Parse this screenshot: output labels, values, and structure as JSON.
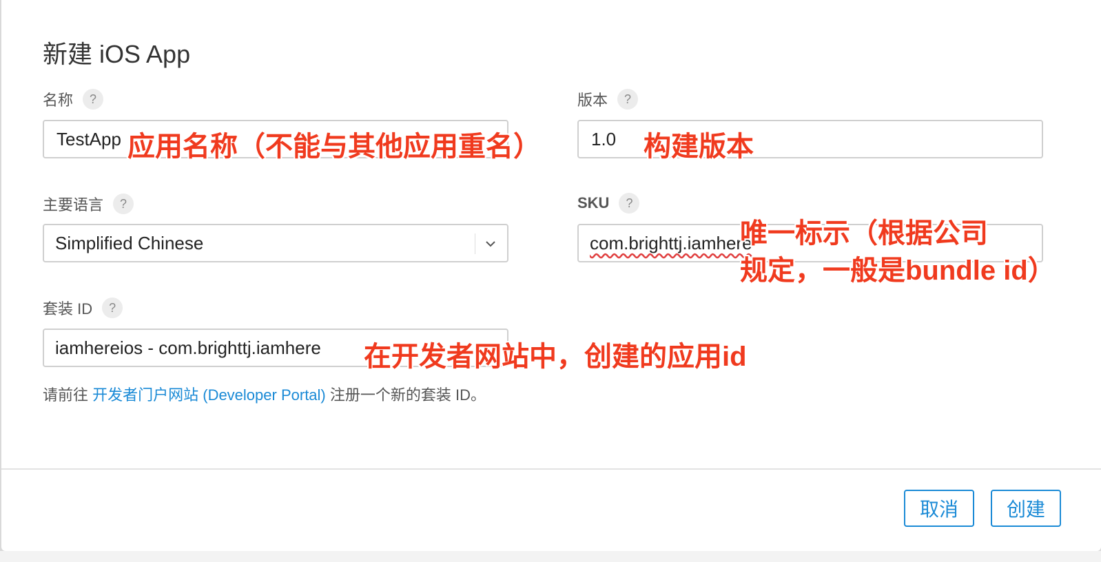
{
  "dialog": {
    "title": "新建 iOS App",
    "help_symbol": "?",
    "fields": {
      "name": {
        "label": "名称",
        "value": "TestApp"
      },
      "version": {
        "label": "版本",
        "value": "1.0"
      },
      "language": {
        "label": "主要语言",
        "value": "Simplified Chinese"
      },
      "sku": {
        "label": "SKU",
        "value": "com.brighttj.iamhere"
      },
      "bundle_id": {
        "label": "套装 ID",
        "value": "iamhereios - com.brighttj.iamhere"
      }
    },
    "hint": {
      "prefix": "请前往 ",
      "link": "开发者门户网站 (Developer Portal)",
      "suffix": " 注册一个新的套装 ID。"
    },
    "buttons": {
      "cancel": "取消",
      "create": "创建"
    }
  },
  "annotations": {
    "name": "应用名称（不能与其他应用重名）",
    "version": "构建版本",
    "sku_line1": "唯一标示（根据公司",
    "sku_line2": "规定，一般是bundle id）",
    "bundle": "在开发者网站中，创建的应用id"
  },
  "colors": {
    "accent": "#1a8ad6",
    "annotation": "#f03a1e"
  }
}
